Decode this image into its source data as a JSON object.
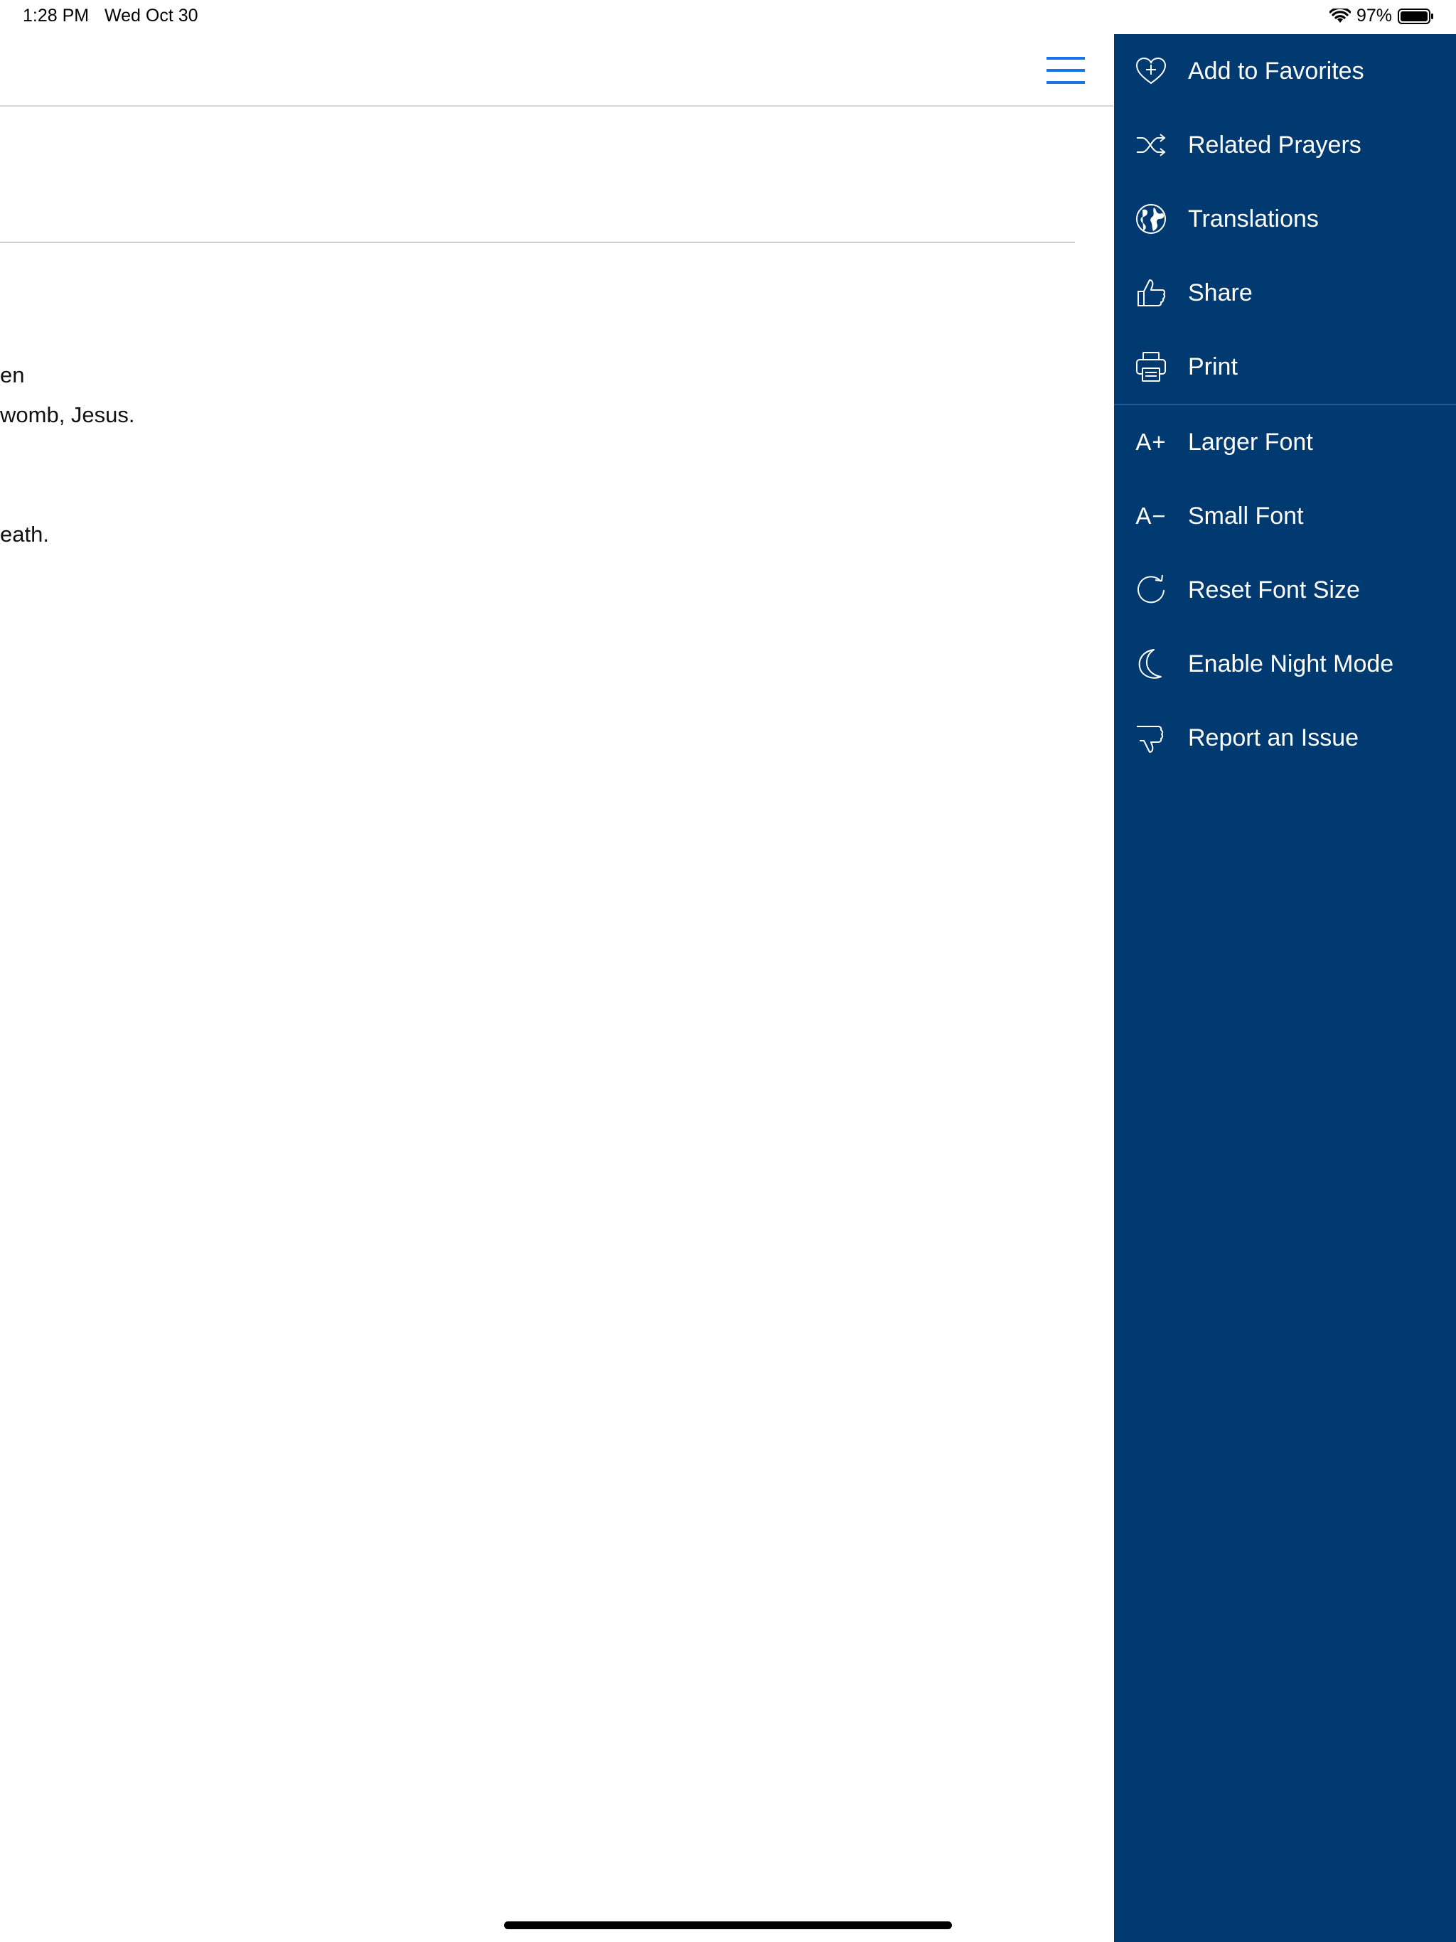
{
  "status_bar": {
    "time": "1:28 PM",
    "date": "Wed Oct 30",
    "battery_percent": "97%"
  },
  "prayer": {
    "lines": [
      "en",
      "womb, Jesus.",
      "eath."
    ]
  },
  "menu": {
    "group1": [
      {
        "label": "Add to Favorites",
        "icon": "heart-plus-icon"
      },
      {
        "label": "Related Prayers",
        "icon": "shuffle-icon"
      },
      {
        "label": "Translations",
        "icon": "globe-icon"
      },
      {
        "label": "Share",
        "icon": "thumbs-up-icon"
      },
      {
        "label": "Print",
        "icon": "printer-icon"
      }
    ],
    "group2": [
      {
        "label": "Larger Font",
        "icon_text": "A+",
        "icon": "font-larger-icon"
      },
      {
        "label": "Small Font",
        "icon_text": "A−",
        "icon": "font-smaller-icon"
      },
      {
        "label": "Reset Font Size",
        "icon": "reset-icon"
      },
      {
        "label": "Enable Night Mode",
        "icon": "moon-icon"
      },
      {
        "label": "Report an Issue",
        "icon": "thumbs-down-icon"
      }
    ]
  },
  "colors": {
    "menu_background": "#003a70",
    "accent_blue": "#1a73e8"
  }
}
